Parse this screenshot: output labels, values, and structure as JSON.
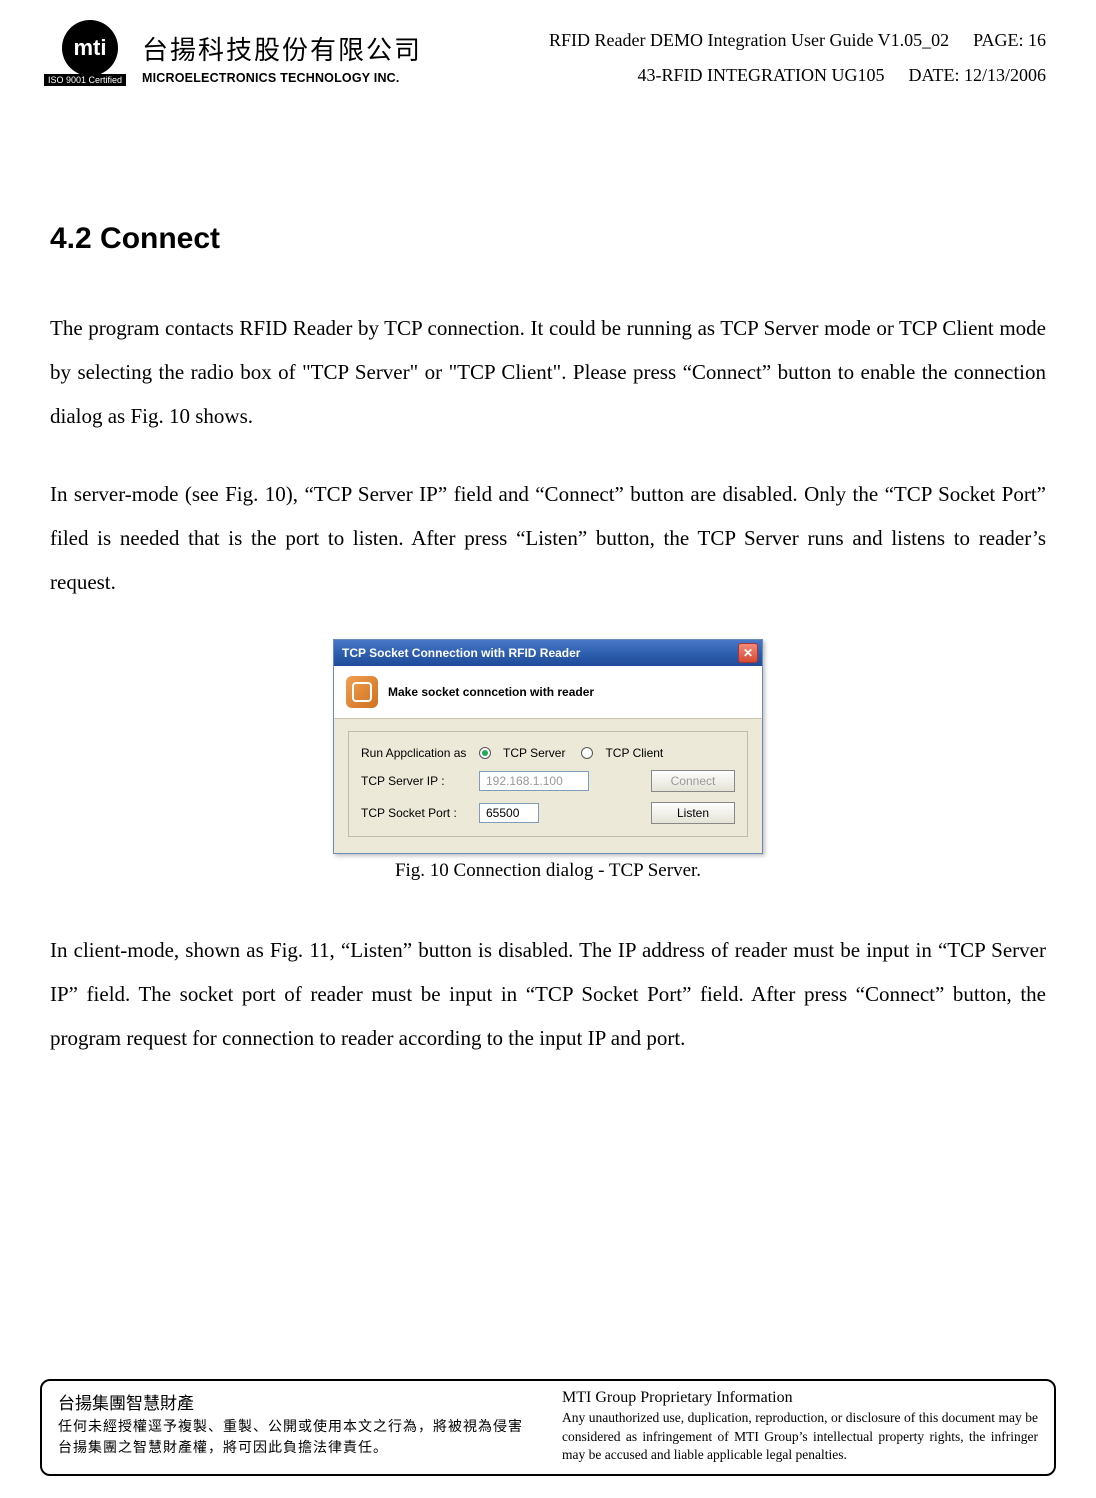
{
  "header": {
    "logo_text": "mti",
    "iso_label": "ISO 9001 Certified",
    "company_cn": "台揚科技股份有限公司",
    "company_en": "MICROELECTRONICS TECHNOLOGY INC.",
    "doc_title": "RFID Reader DEMO Integration User Guide V1.05_02",
    "page_label": "PAGE: 16",
    "doc_number": "43-RFID INTEGRATION UG105",
    "date_label": "DATE: 12/13/2006"
  },
  "section": {
    "heading": "4.2  Connect",
    "para1": "The program contacts RFID Reader by TCP connection.   It could be running as TCP Server mode or TCP Client mode by selecting the radio box of \"TCP Server\" or \"TCP Client\".   Please press “Connect” button to enable the connection dialog as Fig. 10 shows.",
    "para2": "In server-mode (see Fig. 10), “TCP Server IP” field and “Connect” button are disabled.   Only the “TCP Socket Port” filed is needed that is the port to listen.   After press “Listen” button, the TCP Server runs and listens to reader’s request.",
    "para3": "In client-mode, shown as Fig. 11, “Listen” button is disabled.   The IP address of reader must be input in “TCP Server IP” field.   The socket port of reader must be input in “TCP Socket Port” field.   After press “Connect” button, the program request for connection to reader according to the input IP and port."
  },
  "dialog": {
    "title": "TCP Socket Connection with RFID Reader",
    "head_text": "Make socket conncetion with reader",
    "run_label": "Run Appclication as",
    "radio_server": "TCP Server",
    "radio_client": "TCP Client",
    "ip_label": "TCP Server IP :",
    "ip_value": "192.168.1.100",
    "connect_btn": "Connect",
    "port_label": "TCP Socket Port :",
    "port_value": "65500",
    "listen_btn": "Listen",
    "caption": "Fig. 10   Connection dialog - TCP Server."
  },
  "footer": {
    "left_title": "台揚集團智慧財產",
    "left_body": "任何未經授權逕予複製、重製、公開或使用本文之行為，將被視為侵害台揚集團之智慧財產權，將可因此負擔法律責任。",
    "right_title": "MTI Group Proprietary Information",
    "right_body": "Any unauthorized use, duplication, reproduction, or disclosure of this document may be considered as infringement of MTI Group’s intellectual property rights, the infringer may be accused and liable applicable legal penalties."
  }
}
